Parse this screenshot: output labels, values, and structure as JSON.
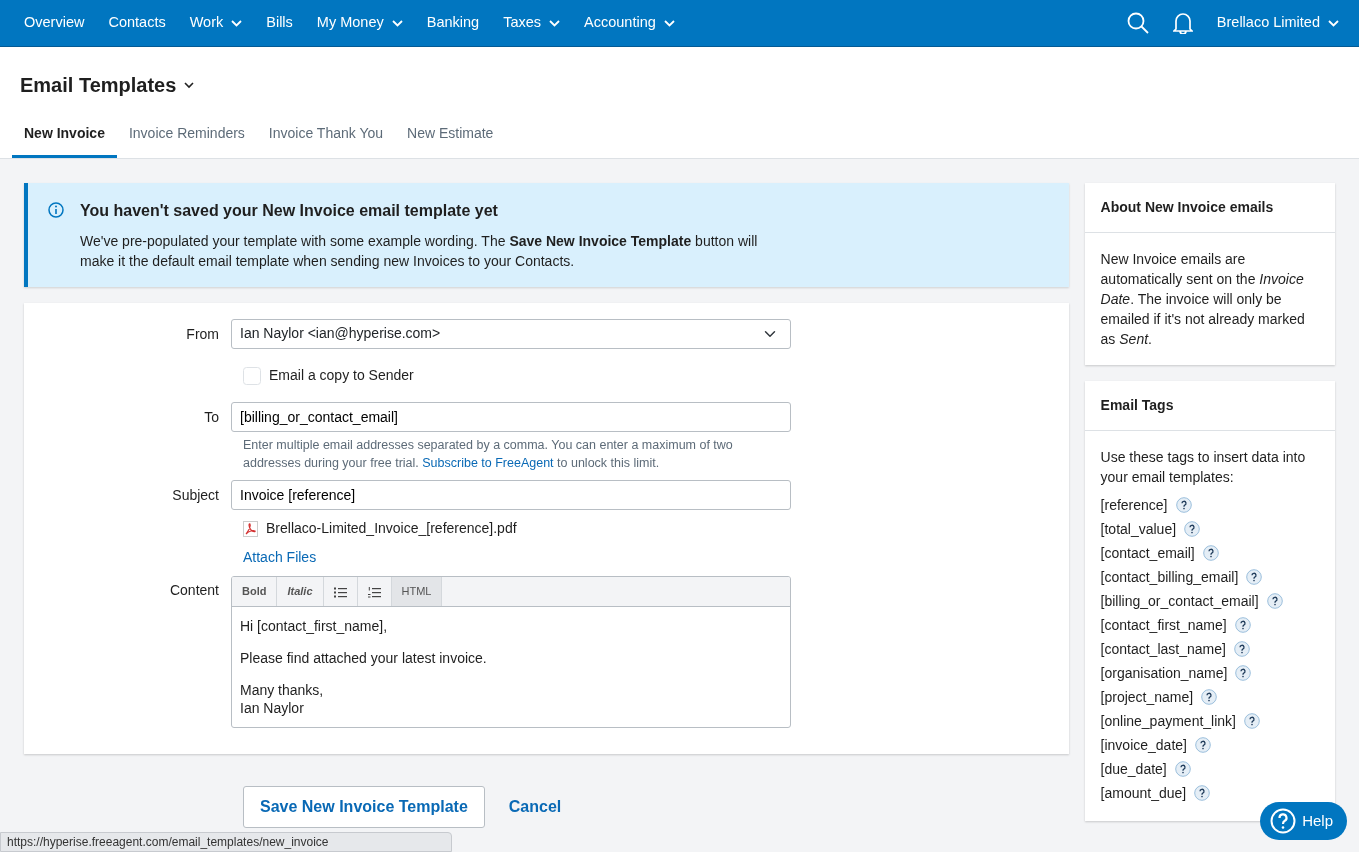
{
  "navbar": {
    "items": [
      {
        "label": "Overview",
        "dropdown": false
      },
      {
        "label": "Contacts",
        "dropdown": false
      },
      {
        "label": "Work",
        "dropdown": true
      },
      {
        "label": "Bills",
        "dropdown": false
      },
      {
        "label": "My Money",
        "dropdown": true
      },
      {
        "label": "Banking",
        "dropdown": false
      },
      {
        "label": "Taxes",
        "dropdown": true
      },
      {
        "label": "Accounting",
        "dropdown": true
      }
    ],
    "account": "Brellaco Limited"
  },
  "page_title": "Email Templates",
  "tabs": [
    {
      "label": "New Invoice",
      "selected": true
    },
    {
      "label": "Invoice Reminders",
      "selected": false
    },
    {
      "label": "Invoice Thank You",
      "selected": false
    },
    {
      "label": "New Estimate",
      "selected": false
    }
  ],
  "alert": {
    "title": "You haven't saved your New Invoice email template yet",
    "body": "We've pre-populated your template with some example wording. The **Save New Invoice Template** button will make it the default email template when sending new Invoices to your Contacts."
  },
  "form": {
    "from": {
      "label": "From",
      "value": "Ian Naylor <ian@hyperise.com>"
    },
    "copy_to_sender": {
      "label": "Email a copy to Sender",
      "checked": false
    },
    "to": {
      "label": "To",
      "value": "[billing_or_contact_email]",
      "hint_before": "Enter multiple email addresses separated by a comma. You can enter a maximum of two addresses during your free trial.",
      "hint_link": "Subscribe to FreeAgent",
      "hint_after": "to unlock this limit."
    },
    "subject": {
      "label": "Subject",
      "value": "Invoice [reference]"
    },
    "attachment": "Brellaco-Limited_Invoice_[reference].pdf",
    "attach_link": "Attach Files",
    "content": {
      "label": "Content",
      "toolbar": [
        {
          "kind": "bold",
          "label": "Bold",
          "hovered": false
        },
        {
          "kind": "italic",
          "label": "Italic",
          "hovered": false
        },
        {
          "kind": "bullet-list",
          "hovered": false
        },
        {
          "kind": "numbered-list",
          "hovered": false
        },
        {
          "kind": "text",
          "label": "HTML",
          "hovered": true
        }
      ],
      "paragraphs": [
        [
          "Hi [contact_first_name],"
        ],
        [
          "Please find attached your latest invoice."
        ],
        [
          "Many thanks,",
          "Ian Naylor"
        ]
      ]
    }
  },
  "actions": {
    "save": "Save New Invoice Template",
    "cancel": "Cancel"
  },
  "about": {
    "title": "About New Invoice emails",
    "body": "New Invoice emails are automatically sent on the *Invoice Date*. The invoice will only be emailed if it's not already marked as *Sent*."
  },
  "tags": {
    "title": "Email Tags",
    "intro": "Use these tags to insert data into your email templates:",
    "items": [
      "[reference]",
      "[total_value]",
      "[contact_email]",
      "[contact_billing_email]",
      "[billing_or_contact_email]",
      "[contact_first_name]",
      "[contact_last_name]",
      "[organisation_name]",
      "[project_name]",
      "[online_payment_link]",
      "[invoice_date]",
      "[due_date]",
      "[amount_due]"
    ]
  },
  "help": "Help",
  "status_bar": "https://hyperise.freeagent.com/email_templates/new_invoice"
}
